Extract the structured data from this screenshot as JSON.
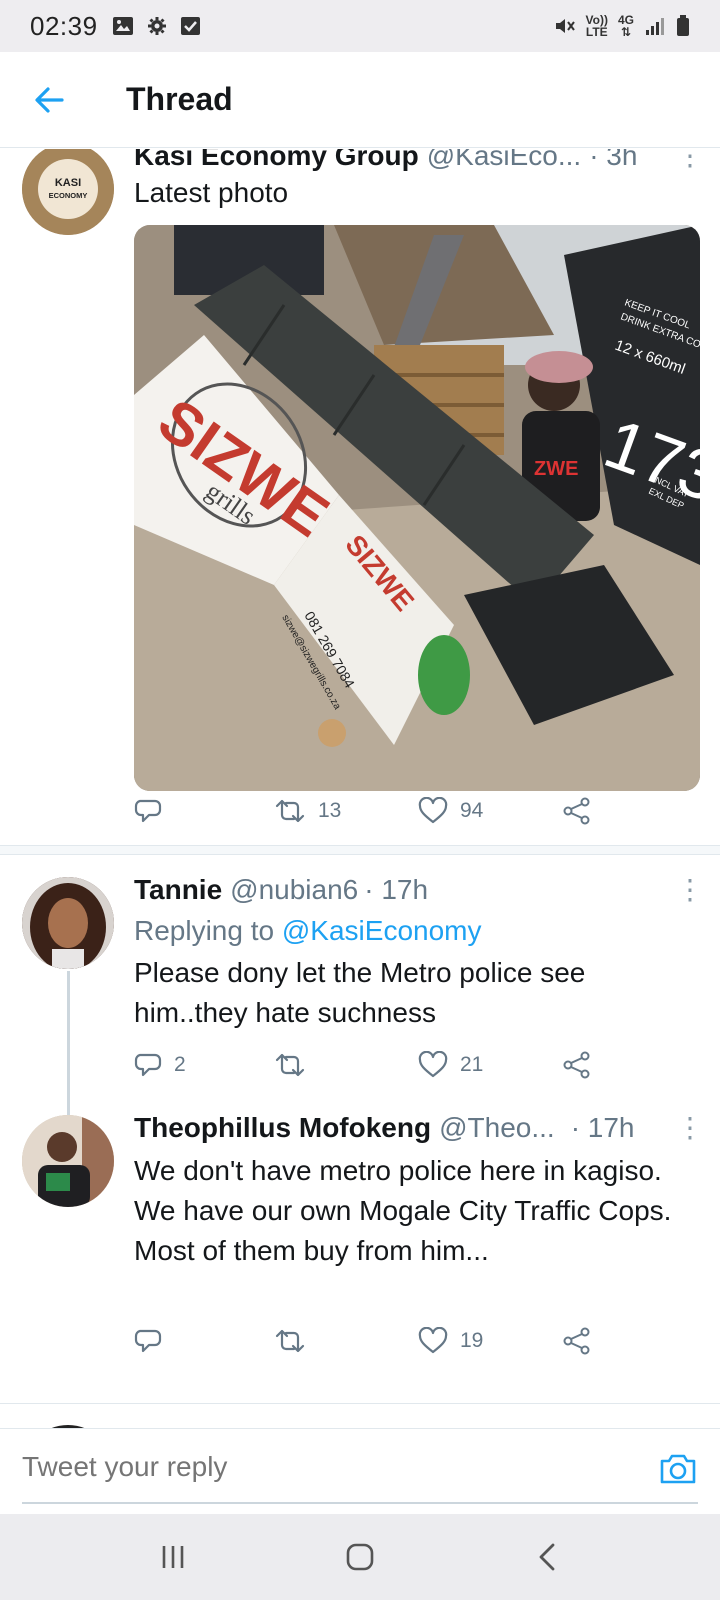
{
  "status_bar": {
    "time": "02:39",
    "network_volte": "Vo))",
    "network_lte": "LTE",
    "network_4g": "4G",
    "icons": [
      "image-icon",
      "gear-icon",
      "check-box-icon",
      "mute-icon",
      "signal-icon",
      "battery-icon"
    ]
  },
  "header": {
    "title": "Thread",
    "back_icon": "arrow-left-icon"
  },
  "tweets": [
    {
      "name": "Kasi Economy Group",
      "handle": "@KasiEco...",
      "time": "· 3h",
      "avatar_text_top": "KASI",
      "avatar_text_bottom": "ECONOMY",
      "text": "Latest photo",
      "photo_texts": {
        "brand": "SIZWE",
        "sub": "grills",
        "phone": "081 269 7084",
        "email": "sizwe@sizwegrills.co.za",
        "billboard_1": "KEEP IT COOL",
        "billboard_2": "DRINK EXTRA COLD",
        "billboard_3": "12 x 660ml",
        "billboard_4": "INCL VAT",
        "billboard_5": "EXL DEP"
      },
      "replies": "",
      "retweets": "13",
      "likes": "94"
    },
    {
      "name": "Tannie",
      "handle": "@nubian6",
      "time": "· 17h",
      "replying_prefix": "Replying to ",
      "replying_to": "@KasiEconomy",
      "text": "Please dony let the Metro police see him..they hate suchness",
      "replies": "2",
      "retweets": "",
      "likes": "21"
    },
    {
      "name": "Theophillus Mofokeng",
      "handle": "@Theo...",
      "time": "· 17h",
      "text": "We don't have metro police here in kagiso. We have our own Mogale City Traffic Cops. Most of them buy from him...",
      "replies": "",
      "retweets": "",
      "likes": "19"
    }
  ],
  "composer": {
    "placeholder": "Tweet your reply"
  },
  "colors": {
    "accent": "#1da1f2",
    "text": "#14171a",
    "secondary": "#657786"
  }
}
